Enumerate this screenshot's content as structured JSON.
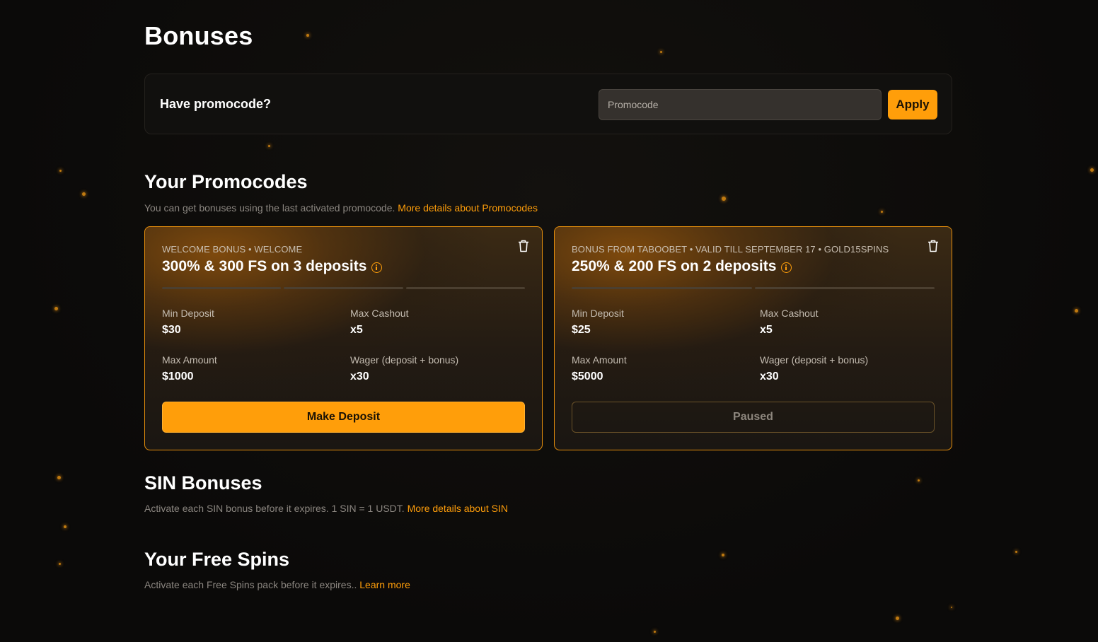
{
  "page": {
    "title": "Bonuses"
  },
  "promo_entry": {
    "label": "Have promocode?",
    "placeholder": "Promocode",
    "apply_label": "Apply"
  },
  "your_promocodes": {
    "title": "Your Promocodes",
    "description": "You can get bonuses using the last activated promocode.",
    "link": "More details about Promocodes",
    "cards": [
      {
        "subtitle": "WELCOME BONUS • WELCOME",
        "title": "300% & 300 FS on 3 deposits",
        "steps_total": 3,
        "min_deposit_label": "Min Deposit",
        "min_deposit": "$30",
        "max_cashout_label": "Max Cashout",
        "max_cashout": "x5",
        "max_amount_label": "Max Amount",
        "max_amount": "$1000",
        "wager_label": "Wager (deposit + bonus)",
        "wager": "x30",
        "action_label": "Make Deposit",
        "action_state": "active"
      },
      {
        "subtitle": "BONUS FROM TABOOBET • VALID TILL SEPTEMBER 17 • GOLD15SPINS",
        "title": "250% & 200 FS on 2 deposits",
        "steps_total": 2,
        "min_deposit_label": "Min Deposit",
        "min_deposit": "$25",
        "max_cashout_label": "Max Cashout",
        "max_cashout": "x5",
        "max_amount_label": "Max Amount",
        "max_amount": "$5000",
        "wager_label": "Wager (deposit + bonus)",
        "wager": "x30",
        "action_label": "Paused",
        "action_state": "disabled"
      }
    ]
  },
  "sin_bonuses": {
    "title": "SIN Bonuses",
    "description": "Activate each SIN bonus before it expires. 1 SIN = 1 USDT.",
    "link": "More details about SIN"
  },
  "free_spins": {
    "title": "Your Free Spins",
    "description": "Activate each Free Spins pack before it expires..",
    "link": "Learn more"
  },
  "colors": {
    "accent": "#ff9e0a",
    "background": "#0b0a09",
    "card_border": "#e58e0c"
  }
}
